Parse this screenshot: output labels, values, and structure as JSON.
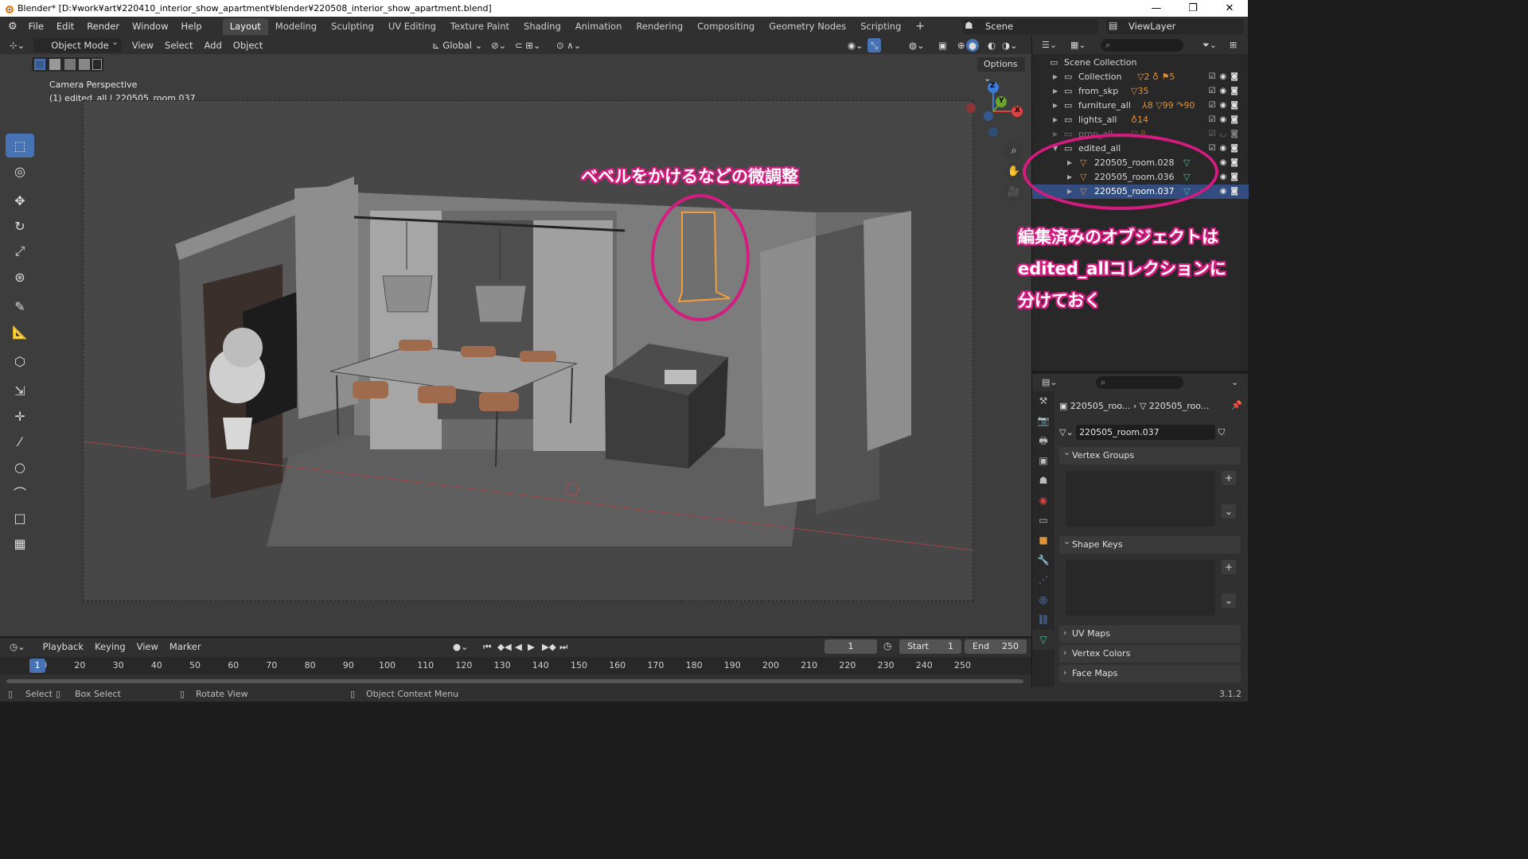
{
  "window": {
    "title": "Blender* [D:¥work¥art¥220410_interior_show_apartment¥blender¥220508_interior_show_apartment.blend]",
    "controls": [
      "—",
      "❐",
      "✕"
    ]
  },
  "menu": [
    "File",
    "Edit",
    "Render",
    "Window",
    "Help"
  ],
  "workspaces": [
    "Layout",
    "Modeling",
    "Sculpting",
    "UV Editing",
    "Texture Paint",
    "Shading",
    "Animation",
    "Rendering",
    "Compositing",
    "Geometry Nodes",
    "Scripting"
  ],
  "active_workspace": "Layout",
  "scene": "Scene",
  "view_layer": "ViewLayer",
  "viewport_header": {
    "mode": "Object Mode",
    "menus": [
      "View",
      "Select",
      "Add",
      "Object"
    ],
    "transform_orientation": "Global",
    "options_label": "Options"
  },
  "viewport": {
    "perspective_label": "Camera Perspective",
    "object_label": "(1) edited_all | 220505_room.037",
    "gizmo_axes": [
      "Z",
      "Y",
      "X"
    ]
  },
  "outliner": {
    "root": "Scene Collection",
    "rows": [
      {
        "name": "Collection",
        "badges": "▽2 ♁ ⚑5"
      },
      {
        "name": "from_skp",
        "badges": "▽35"
      },
      {
        "name": "furniture_all",
        "badges": "⅄8 ▽99 ↷90"
      },
      {
        "name": "lights_all",
        "badges": "♁14"
      },
      {
        "name": "prop_all",
        "badges": "▽ 8"
      },
      {
        "name": "edited_all",
        "badges": ""
      },
      {
        "name": "220505_room.028",
        "badges": ""
      },
      {
        "name": "220505_room.036",
        "badges": ""
      },
      {
        "name": "220505_room.037",
        "badges": ""
      }
    ]
  },
  "properties": {
    "breadcrumb_object": "220505_roo...",
    "breadcrumb_data": "220505_roo...",
    "mesh_name": "220505_room.037",
    "panels": [
      "Vertex Groups",
      "Shape Keys",
      "UV Maps",
      "Vertex Colors",
      "Face Maps"
    ]
  },
  "timeline": {
    "menus": [
      "Playback",
      "Keying",
      "View",
      "Marker"
    ],
    "current_frame": "1",
    "start_label": "Start",
    "start": "1",
    "end_label": "End",
    "end": "250",
    "ruler": [
      "1",
      "10",
      "20",
      "30",
      "40",
      "50",
      "60",
      "70",
      "80",
      "90",
      "100",
      "110",
      "120",
      "130",
      "140",
      "150",
      "160",
      "170",
      "180",
      "190",
      "200",
      "210",
      "220",
      "230",
      "240",
      "250"
    ]
  },
  "statusbar": {
    "select": "Select",
    "box_select": "Box Select",
    "rotate_view": "Rotate View",
    "context_menu": "Object Context Menu",
    "version": "3.1.2"
  },
  "annotations": {
    "bevel_note": "ベベルをかけるなどの微調整",
    "collection_note_1": "編集済みのオブジェクトは",
    "collection_note_2": "edited_allコレクションに",
    "collection_note_3": "分けておく"
  },
  "colors": {
    "accent": "#4772b3",
    "selection": "#334d80",
    "annotation": "#d61b80",
    "active_outline": "#f29d3a"
  }
}
